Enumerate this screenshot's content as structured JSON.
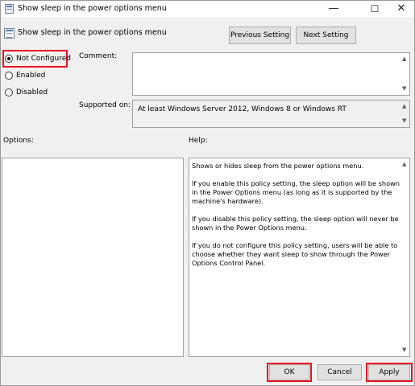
{
  "window": {
    "title": "Show sleep in the power options menu",
    "minimize": "—",
    "maximize": "☐",
    "close": "✕"
  },
  "header": {
    "setting_title": "Show sleep in the power options menu",
    "previous_label": "Previous Setting",
    "next_label": "Next Setting"
  },
  "state": {
    "options": [
      {
        "label": "Not Configured",
        "selected": true
      },
      {
        "label": "Enabled",
        "selected": false
      },
      {
        "label": "Disabled",
        "selected": false
      }
    ]
  },
  "comment": {
    "label": "Comment:",
    "value": ""
  },
  "supported": {
    "label": "Supported on:",
    "value": "At least Windows Server 2012, Windows 8 or Windows RT"
  },
  "options_pane": {
    "label": "Options:"
  },
  "help_pane": {
    "label": "Help:",
    "paragraphs": [
      "Shows or hides sleep from the power options menu.",
      "If you enable this policy setting, the sleep option will be shown in the Power Options menu (as long as it is supported by the machine's hardware).",
      "If you disable this policy setting, the sleep option will never be shown in the Power Options menu.",
      "If you do not configure this policy setting, users will be able to choose whether they want sleep to show through the Power Options Control Panel."
    ]
  },
  "footer": {
    "ok_label": "OK",
    "cancel_label": "Cancel",
    "apply_label": "Apply"
  },
  "icons": {
    "scroll_up": "▲",
    "scroll_down": "▼"
  },
  "colors": {
    "highlight": "#e81123",
    "background": "#f0f0f0",
    "button": "#e1e1e1"
  }
}
